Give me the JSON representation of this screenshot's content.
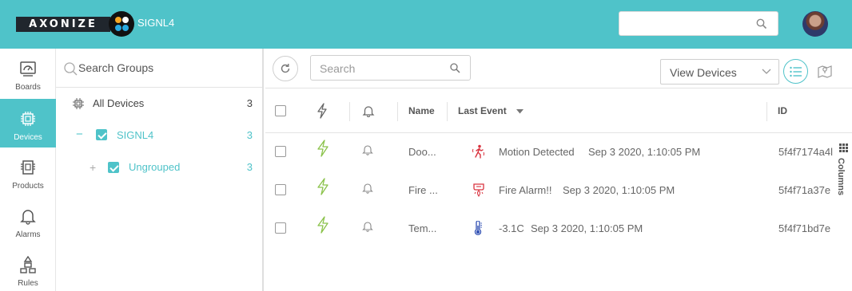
{
  "topbar": {
    "logo_text": "AXONIZE",
    "app_name": "SIGNL4",
    "search_placeholder": "",
    "colors": {
      "bar": "#4fc3c9",
      "logo_bg": "#20262d"
    }
  },
  "nav": {
    "items": [
      {
        "label": "Boards",
        "icon": "boards-icon",
        "active": false
      },
      {
        "label": "Devices",
        "icon": "devices-icon",
        "active": true
      },
      {
        "label": "Products",
        "icon": "products-icon",
        "active": false
      },
      {
        "label": "Alarms",
        "icon": "bell-icon",
        "active": false
      },
      {
        "label": "Rules",
        "icon": "rules-icon",
        "active": false
      }
    ]
  },
  "groups": {
    "search_placeholder": "Search Groups",
    "items": [
      {
        "name": "All Devices",
        "count": "3"
      },
      {
        "name": "SIGNL4",
        "count": "3",
        "toggle": "−",
        "checked": true
      },
      {
        "name": "Ungrouped",
        "count": "3",
        "toggle": "+",
        "checked": true
      }
    ]
  },
  "main": {
    "search_placeholder": "Search",
    "view_select": "View Devices",
    "columns_label": "Columns",
    "headers": {
      "name": "Name",
      "last_event": "Last Event",
      "id": "ID"
    },
    "rows": [
      {
        "name": "Doo...",
        "event_icon": "motion-icon",
        "event": "Motion Detected",
        "time": "Sep 3 2020, 1:10:05 PM",
        "id": "5f4f7174a4l"
      },
      {
        "name": "Fire ...",
        "event_icon": "fire-alarm-icon",
        "event": "Fire Alarm!!",
        "time": "Sep 3 2020, 1:10:05 PM",
        "id": "5f4f71a37e"
      },
      {
        "name": "Tem...",
        "event_icon": "thermometer-icon",
        "event": "-3.1C",
        "time": "Sep 3 2020, 1:10:05 PM",
        "id": "5f4f71bd7e"
      }
    ]
  }
}
